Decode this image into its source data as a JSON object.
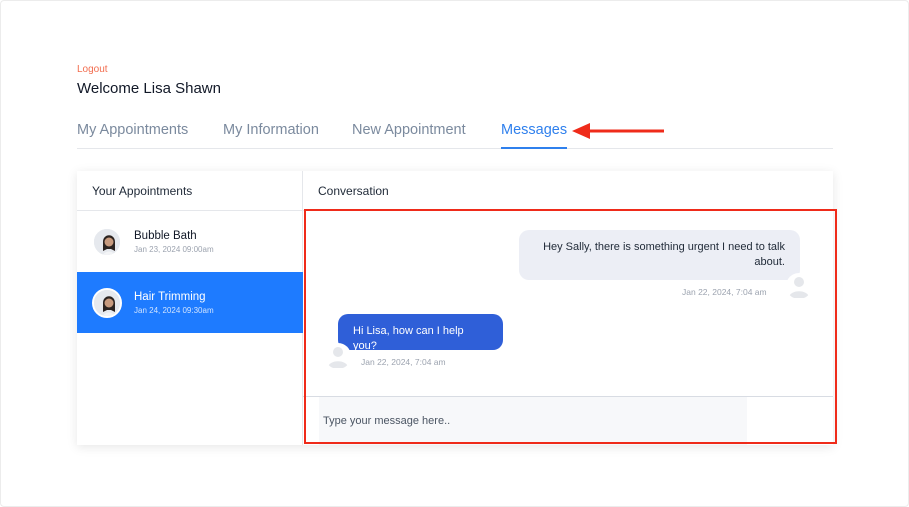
{
  "header": {
    "logout_label": "Logout",
    "welcome_text": "Welcome Lisa Shawn"
  },
  "tabs": [
    {
      "label": "My Appointments",
      "active": false
    },
    {
      "label": "My Information",
      "active": false
    },
    {
      "label": "New Appointment",
      "active": false
    },
    {
      "label": "Messages",
      "active": true
    }
  ],
  "appointments_panel": {
    "title": "Your Appointments",
    "items": [
      {
        "name": "Bubble Bath",
        "date": "Jan 23, 2024 09:00am",
        "selected": false
      },
      {
        "name": "Hair Trimming",
        "date": "Jan 24, 2024 09:30am",
        "selected": true
      }
    ]
  },
  "conversation": {
    "title": "Conversation",
    "messages": [
      {
        "direction": "outgoing",
        "text": "Hey Sally, there is something urgent I need to talk about.",
        "timestamp": "Jan 22, 2024, 7:04 am"
      },
      {
        "direction": "incoming",
        "text": "Hi Lisa, how can I help you?",
        "timestamp": "Jan 22, 2024, 7:04 am"
      }
    ],
    "composer": {
      "placeholder": "Type your message here..",
      "value": ""
    }
  },
  "colors": {
    "accent": "#2f80ed",
    "selected_row": "#1e7bff",
    "incoming_bubble": "#2f5fd8",
    "outgoing_bubble": "#eceef5",
    "logout": "#f26d4f",
    "annotation": "#ef2b1a"
  }
}
